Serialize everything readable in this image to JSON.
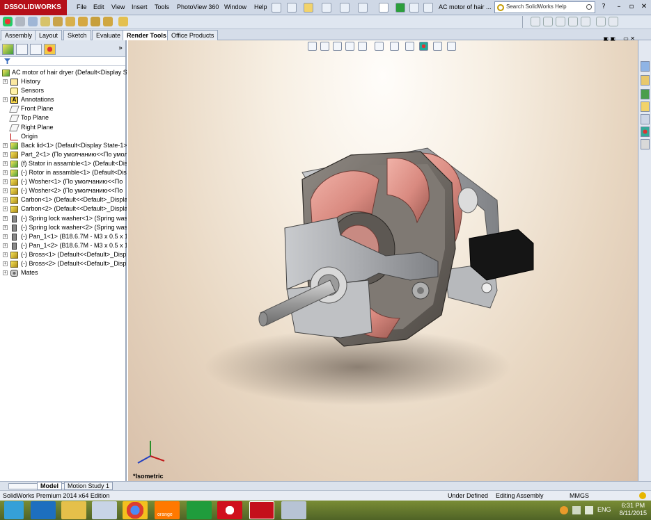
{
  "app": {
    "logo_text": "SOLIDWORKS",
    "document_title": "AC motor of hair ...",
    "search_placeholder": "Search SolidWorks Help"
  },
  "menu": [
    "File",
    "Edit",
    "View",
    "Insert",
    "Tools",
    "PhotoView 360",
    "Window",
    "Help"
  ],
  "command_tabs": [
    "Assembly",
    "Layout",
    "Sketch",
    "Evaluate",
    "Render Tools",
    "Office Products"
  ],
  "active_command_tab": "Render Tools",
  "feature_tree": {
    "root": "AC motor of hair dryer  (Default<Display St",
    "items": [
      {
        "label": "History",
        "icon": "history-icon",
        "expandable": true
      },
      {
        "label": "Sensors",
        "icon": "sensors-icon",
        "expandable": false
      },
      {
        "label": "Annotations",
        "icon": "annotations-icon",
        "expandable": true
      },
      {
        "label": "Front Plane",
        "icon": "plane-icon",
        "expandable": false
      },
      {
        "label": "Top Plane",
        "icon": "plane-icon",
        "expandable": false
      },
      {
        "label": "Right Plane",
        "icon": "plane-icon",
        "expandable": false
      },
      {
        "label": "Origin",
        "icon": "origin-icon",
        "expandable": false
      },
      {
        "label": "Back lid<1> (Default<Display State-1>)",
        "icon": "subassembly-icon",
        "expandable": true
      },
      {
        "label": "Part_2<1> (По умолчанию<<По умол",
        "icon": "part-icon",
        "expandable": true
      },
      {
        "label": "(f) Stator in assamble<1> (Default<Disp",
        "icon": "subassembly-icon",
        "expandable": true
      },
      {
        "label": "(-) Rotor in assamble<1> (Default<Disp",
        "icon": "subassembly-icon",
        "expandable": true
      },
      {
        "label": "(-) Wosher<1> (По умолчанию<<По",
        "icon": "part-icon",
        "expandable": true
      },
      {
        "label": "(-) Wosher<2> (По умолчанию<<По",
        "icon": "part-icon",
        "expandable": true
      },
      {
        "label": "Carbon<1> (Default<<Default>_Displa",
        "icon": "part-icon",
        "expandable": true
      },
      {
        "label": "Carbon<2> (Default<<Default>_Displa",
        "icon": "part-icon",
        "expandable": true
      },
      {
        "label": "(-) Spring lock washer<1> (Spring wash",
        "icon": "screw-icon",
        "expandable": true
      },
      {
        "label": "(-) Spring lock washer<2> (Spring wash",
        "icon": "screw-icon",
        "expandable": true
      },
      {
        "label": "(-) Pan_1<1> (B18.6.7M - M3 x 0.5 x 16",
        "icon": "screw-icon",
        "expandable": true
      },
      {
        "label": "(-) Pan_1<2> (B18.6.7M - M3 x 0.5 x 16",
        "icon": "screw-icon",
        "expandable": true
      },
      {
        "label": "(-) Bross<1> (Default<<Default>_Displa",
        "icon": "part-icon",
        "expandable": true
      },
      {
        "label": "(-) Bross<2> (Default<<Default>_Displa",
        "icon": "part-icon",
        "expandable": true
      },
      {
        "label": "Mates",
        "icon": "mates-icon",
        "expandable": true
      }
    ]
  },
  "viewport": {
    "view_label": "*Isometric"
  },
  "bottom_tabs": [
    "Model",
    "Motion Study 1"
  ],
  "active_bottom_tab": "Model",
  "status": {
    "product": "SolidWorks Premium 2014 x64 Edition",
    "definition": "Under Defined",
    "mode": "Editing Assembly",
    "units": "MMGS"
  },
  "taskbar": {
    "language": "ENG",
    "time": "6:31 PM",
    "date": "8/11/2015",
    "orange_label": "orange"
  },
  "colors": {
    "logo_red": "#b50f19",
    "coil_copper": "#d98a80",
    "taskbar": "#5a6c2a"
  }
}
